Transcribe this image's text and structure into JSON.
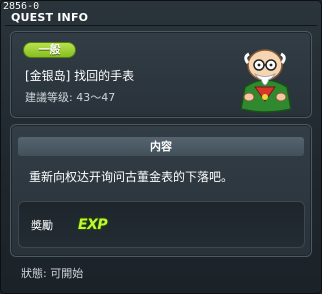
{
  "window": {
    "id_tag": "2856-0",
    "title": "QUEST INFO"
  },
  "quest": {
    "category_badge": "一般",
    "name": "[金银岛] 找回的手表",
    "level_range": "建議等级: 43～47",
    "npc_icon": "old-man-npc-portrait"
  },
  "content": {
    "header": "内容",
    "description": "重新向权达开询问古董金表的下落吧。"
  },
  "reward": {
    "label": "奬勵",
    "exp_icon_text": "EXP"
  },
  "footer": {
    "status": "狀態: 可開始"
  },
  "colors": {
    "badge_green": "#9fd22f",
    "exp_green": "#c4f43a",
    "background": "#1f272d"
  }
}
